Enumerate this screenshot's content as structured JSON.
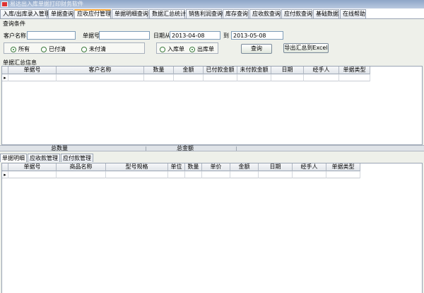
{
  "window": {
    "title": "易达出入库单据打印财务软件"
  },
  "tabs": [
    {
      "label": "入库/出库录入管理",
      "w": 67
    },
    {
      "label": "单据查询",
      "w": 36
    },
    {
      "label": "应收应付管理",
      "w": 52,
      "active": true
    },
    {
      "label": "单据明细查询",
      "w": 52
    },
    {
      "label": "数据汇总统计",
      "w": 51
    },
    {
      "label": "销售利润查询",
      "w": 51
    },
    {
      "label": "库存查询",
      "w": 37
    },
    {
      "label": "应收款查询",
      "w": 44
    },
    {
      "label": "应付款查询",
      "w": 44
    },
    {
      "label": "基础数据",
      "w": 37
    },
    {
      "label": "在线帮助",
      "w": 37
    }
  ],
  "query": {
    "group_label": "查询条件",
    "customer_label": "客户名称",
    "customer_value": "",
    "doc_no_label": "单据号",
    "doc_no_value": "",
    "date_from_label": "日期从",
    "date_from_value": "2013-04-08",
    "date_to_label": "到",
    "date_to_value": "2013-05-08",
    "status_options": [
      "所有",
      "已付清",
      "未付清"
    ],
    "status_selected": "所有",
    "type_options": [
      "入库单",
      "出库单"
    ],
    "type_selected": "出库单",
    "query_button": "查询",
    "export_button": "导出汇总到Excel"
  },
  "summary_grid": {
    "label": "单据汇总信息",
    "columns": [
      {
        "label": "单据号",
        "w": 68
      },
      {
        "label": "客户名称",
        "w": 124
      },
      {
        "label": "数量",
        "w": 42
      },
      {
        "label": "金额",
        "w": 42
      },
      {
        "label": "已付款金额",
        "w": 48
      },
      {
        "label": "未付款金额",
        "w": 48
      },
      {
        "label": "日期",
        "w": 46
      },
      {
        "label": "经手人",
        "w": 50
      },
      {
        "label": "单据类型",
        "w": 44
      }
    ]
  },
  "totals": {
    "quantity_label": "总数量",
    "amount_label": "总金额"
  },
  "sub_tabs": [
    {
      "label": "单据明细",
      "active": true
    },
    {
      "label": "应收款管理"
    },
    {
      "label": "应付款管理"
    }
  ],
  "detail_grid": {
    "columns": [
      {
        "label": "单据号",
        "w": 68
      },
      {
        "label": "商品名称",
        "w": 70
      },
      {
        "label": "型号规格",
        "w": 88
      },
      {
        "label": "单位",
        "w": 24
      },
      {
        "label": "数量",
        "w": 24
      },
      {
        "label": "单价",
        "w": 40
      },
      {
        "label": "金额",
        "w": 40
      },
      {
        "label": "日期",
        "w": 48
      },
      {
        "label": "经手人",
        "w": 48
      },
      {
        "label": "单据类型",
        "w": 48
      }
    ]
  },
  "colors": {
    "active_tab_accent": "#f2a53a",
    "panel_bg": "#eef0ea",
    "titlebar": "#8ea6c8"
  }
}
